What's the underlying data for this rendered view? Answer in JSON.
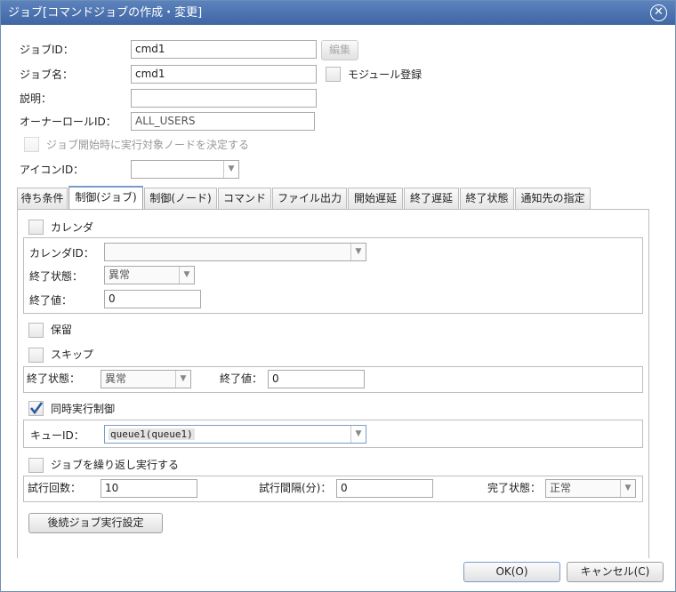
{
  "window": {
    "title": "ジョブ[コマンドジョブの作成・変更]"
  },
  "form": {
    "job_id_label": "ジョブID：",
    "job_id_value": "cmd1",
    "edit_label": "編集",
    "job_name_label": "ジョブ名：",
    "job_name_value": "cmd1",
    "module_register_label": "モジュール登録",
    "description_label": "説明：",
    "description_value": "",
    "owner_role_label": "オーナーロールID：",
    "owner_role_value": "ALL_USERS",
    "decide_node_label": "ジョブ開始時に実行対象ノードを決定する",
    "icon_id_label": "アイコンID：",
    "icon_id_value": ""
  },
  "tabs": [
    "待ち条件",
    "制御(ジョブ)",
    "制御(ノード)",
    "コマンド",
    "ファイル出力",
    "開始遅延",
    "終了遅延",
    "終了状態",
    "通知先の指定"
  ],
  "control": {
    "calendar_label": "カレンダ",
    "calendar_id_label": "カレンダID：",
    "calendar_id_value": "",
    "end_status_label": "終了状態：",
    "calendar_end_status_value": "異常",
    "end_value_label": "終了値：",
    "calendar_end_value": "0",
    "hold_label": "保留",
    "skip_label": "スキップ",
    "skip_end_status_value": "異常",
    "skip_end_value": "0",
    "concurrency_label": "同時実行制御",
    "concurrency_checked": true,
    "queue_id_label": "キューID：",
    "queue_id_value": "queue1(queue1)",
    "repeat_label": "ジョブを繰り返し実行する",
    "retry_count_label": "試行回数：",
    "retry_count_value": "10",
    "retry_interval_label": "試行間隔(分)：",
    "retry_interval_value": "0",
    "complete_status_label": "完了状態：",
    "complete_status_value": "正常",
    "followup_button": "後続ジョブ実行設定"
  },
  "footer": {
    "ok_label": "OK(O)",
    "cancel_label": "キャンセル(C)"
  },
  "colors": {
    "titlebar": "#4a72ae",
    "active_tab_accent": "#7a9cc8",
    "check_mark": "#2a5aa0"
  }
}
